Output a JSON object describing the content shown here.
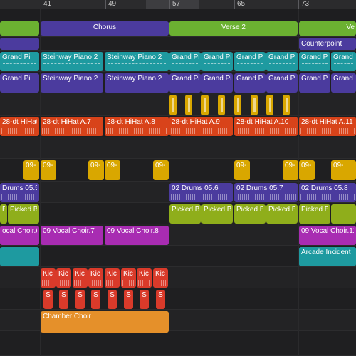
{
  "ruler": {
    "bars": [
      "41",
      "49",
      "57",
      "65",
      "73"
    ]
  },
  "colors": {
    "green": "#6bb131",
    "purple_dark": "#4b3b9e",
    "teal": "#1e9aa0",
    "yellow": "#d9a700",
    "orange_red": "#d8431a",
    "magenta": "#a82cb2",
    "orange": "#e5902a",
    "red": "#d93a2a",
    "background": "#1e1e20"
  },
  "markers": {
    "partial_left": "",
    "chorus": "Chorus",
    "verse2": "Verse 2",
    "partial_right": "Ve",
    "counterpoint": "Counterpoint"
  },
  "regions": {
    "piano1": [
      "Grand Pi",
      "Steinway Piano 2",
      "Steinway Piano 2",
      "Grand Pi",
      "Grand Pi",
      "Grand Pi",
      "Grand Pi",
      "Grand Pi",
      "Grand Pi"
    ],
    "piano2": [
      "Grand Pi",
      "Steinway Piano 2",
      "Steinway Piano 2",
      "Grand Pi",
      "Grand Pi",
      "Grand Pi",
      "Grand Pi",
      "Grand Pi",
      "Grand Pi"
    ],
    "hihat": [
      "28-dt HiHat A.6",
      "28-dt HiHat A.7",
      "28-dt HiHat A.8",
      "28-dt HiHat A.9",
      "28-dt HiHat A.10",
      "28-dt HiHat A.11"
    ],
    "perc": [
      "09-",
      "09-",
      "09-",
      "09-",
      "09-",
      "09-",
      "09-",
      "09-",
      "09-"
    ],
    "drums": [
      "Drums 05.5",
      "02 Drums 05.6",
      "02 Drums 05.7",
      "02 Drums 05.8"
    ],
    "picked": [
      "B",
      "Picked B",
      "Picked B",
      "Picked B",
      "Picked B",
      "Picked B",
      "Picked B"
    ],
    "vocal": [
      "ocal Choir.6",
      "09 Vocal Choir.7",
      "09 Vocal Choir.8",
      "09 Vocal Choir.11"
    ],
    "arcade": "Arcade Incident",
    "kick": [
      "Kic",
      "Kic",
      "Kic",
      "Kic",
      "Kic",
      "Kic",
      "Kic",
      "Kic"
    ],
    "snare": [
      "S",
      "S",
      "S",
      "S",
      "S",
      "S",
      "S",
      "S"
    ],
    "chamber": "Chamber Choir"
  }
}
